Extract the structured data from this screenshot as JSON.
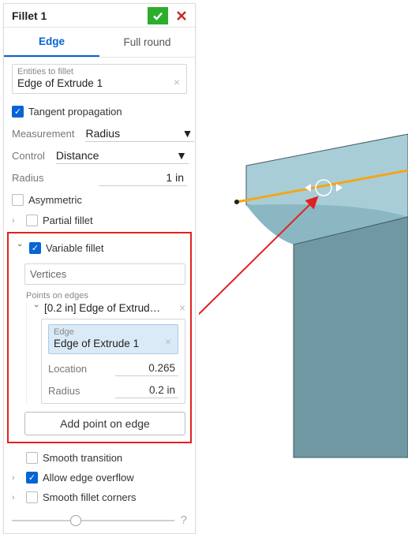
{
  "accent": "#0764d4",
  "danger": "#e22020",
  "header": {
    "title": "Fillet 1"
  },
  "tabs": {
    "edge": "Edge",
    "full_round": "Full round",
    "active": "edge"
  },
  "entities": {
    "caption": "Entities to fillet",
    "value": "Edge of Extrude 1"
  },
  "tangent_propagation": {
    "label": "Tangent propagation",
    "checked": true
  },
  "measurement": {
    "label": "Measurement",
    "value": "Radius"
  },
  "control": {
    "label": "Control",
    "value": "Distance"
  },
  "radius": {
    "label": "Radius",
    "value": "1 in"
  },
  "asymmetric": {
    "label": "Asymmetric",
    "checked": false
  },
  "partial_fillet": {
    "label": "Partial fillet",
    "checked": false,
    "expanded": false
  },
  "variable_fillet": {
    "label": "Variable fillet",
    "checked": true,
    "expanded": true,
    "vertices_placeholder": "Vertices",
    "points_caption": "Points on edges",
    "item": {
      "title": "[0.2 in] Edge of Extrud…",
      "edge_caption": "Edge",
      "edge_value": "Edge of Extrude 1",
      "location_label": "Location",
      "location_value": "0.265",
      "radius_label": "Radius",
      "radius_value": "0.2 in"
    },
    "add_point_label": "Add point on edge"
  },
  "smooth_transition": {
    "label": "Smooth transition",
    "checked": false
  },
  "allow_edge_overflow": {
    "label": "Allow edge overflow",
    "checked": true,
    "expanded": false
  },
  "smooth_fillet_corners": {
    "label": "Smooth fillet corners",
    "checked": false,
    "expanded": false
  },
  "model": {
    "body_color": "#96bfc9",
    "edge_highlight": "#f2a61a"
  }
}
